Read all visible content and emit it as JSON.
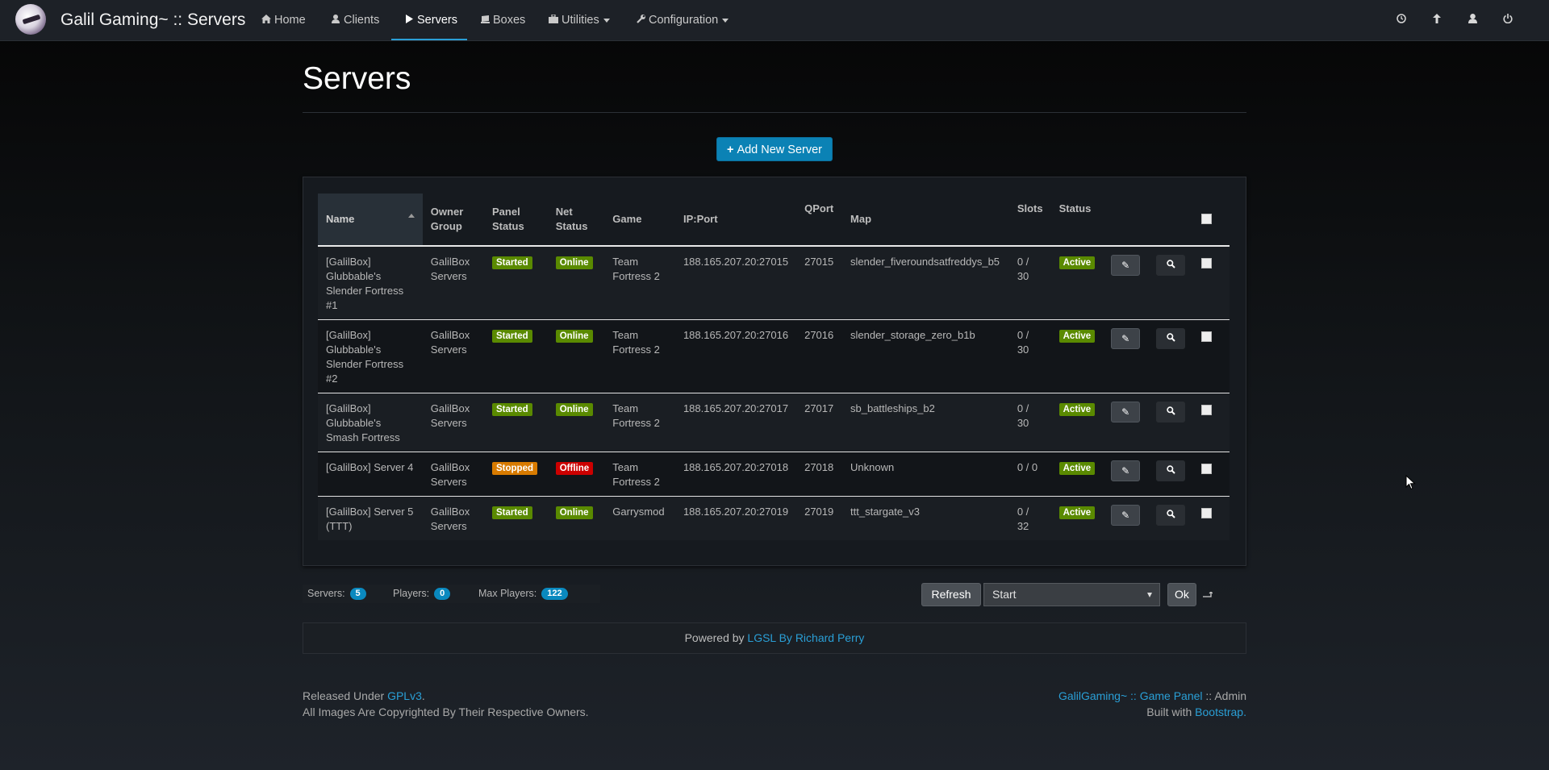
{
  "nav": {
    "brand": "Galil Gaming~ :: Servers",
    "items": [
      {
        "label": "Home",
        "icon": "home-icon"
      },
      {
        "label": "Clients",
        "icon": "user-icon"
      },
      {
        "label": "Servers",
        "icon": "play-icon",
        "active": true
      },
      {
        "label": "Boxes",
        "icon": "box-icon"
      },
      {
        "label": "Utilities",
        "icon": "briefcase-icon",
        "dropdown": true
      },
      {
        "label": "Configuration",
        "icon": "wrench-icon",
        "dropdown": true
      }
    ],
    "right_icons": [
      "clock-icon",
      "upload-icon",
      "user-icon",
      "power-icon"
    ]
  },
  "page": {
    "title": "Servers",
    "add_button": "Add New Server"
  },
  "table": {
    "headers": {
      "name": "Name",
      "owner_group": "Owner Group",
      "panel_status": "Panel Status",
      "net_status": "Net Status",
      "game": "Game",
      "ip_port": "IP:Port",
      "qport": "QPort",
      "map": "Map",
      "slots": "Slots",
      "status": "Status"
    },
    "rows": [
      {
        "name": "[GalilBox] Glubbable's Slender Fortress #1",
        "owner": "GalilBox Servers",
        "panel": "Started",
        "net": "Online",
        "game": "Team Fortress 2",
        "ip": "188.165.207.20:27015",
        "qport": "27015",
        "map": "slender_fiveroundsatfreddys_b5",
        "slots": "0 / 30",
        "status": "Active"
      },
      {
        "name": "[GalilBox] Glubbable's Slender Fortress #2",
        "owner": "GalilBox Servers",
        "panel": "Started",
        "net": "Online",
        "game": "Team Fortress 2",
        "ip": "188.165.207.20:27016",
        "qport": "27016",
        "map": "slender_storage_zero_b1b",
        "slots": "0 / 30",
        "status": "Active"
      },
      {
        "name": "[GalilBox] Glubbable's Smash Fortress",
        "owner": "GalilBox Servers",
        "panel": "Started",
        "net": "Online",
        "game": "Team Fortress 2",
        "ip": "188.165.207.20:27017",
        "qport": "27017",
        "map": "sb_battleships_b2",
        "slots": "0 / 30",
        "status": "Active"
      },
      {
        "name": "[GalilBox] Server 4",
        "owner": "GalilBox Servers",
        "panel": "Stopped",
        "net": "Offline",
        "game": "Team Fortress 2",
        "ip": "188.165.207.20:27018",
        "qport": "27018",
        "map": "Unknown",
        "slots": "0 / 0",
        "status": "Active"
      },
      {
        "name": "[GalilBox] Server 5 (TTT)",
        "owner": "GalilBox Servers",
        "panel": "Started",
        "net": "Online",
        "game": "Garrysmod",
        "ip": "188.165.207.20:27019",
        "qport": "27019",
        "map": "ttt_stargate_v3",
        "slots": "0 / 32",
        "status": "Active"
      }
    ]
  },
  "stats": {
    "servers_label": "Servers:",
    "servers": "5",
    "players_label": "Players:",
    "players": "0",
    "max_players_label": "Max Players:",
    "max_players": "122"
  },
  "actions": {
    "refresh": "Refresh",
    "select_value": "Start",
    "ok": "Ok"
  },
  "powered": {
    "prefix": "Powered by",
    "link": "LGSL By Richard Perry"
  },
  "footer": {
    "released_prefix": "Released Under",
    "license": "GPLv3",
    "dot": ".",
    "copyright": "All Images Are Copyrighted By Their Respective Owners.",
    "panel_link": "GalilGaming~ :: Game Panel",
    "panel_suffix": " :: Admin",
    "built_prefix": "Built with",
    "bootstrap": "Bootstrap."
  },
  "colors": {
    "accent": "#2a9fd6",
    "started": "#5a8a00",
    "stopped": "#d87b00",
    "offline": "#cc0000",
    "add_button": "#0b82b5"
  }
}
